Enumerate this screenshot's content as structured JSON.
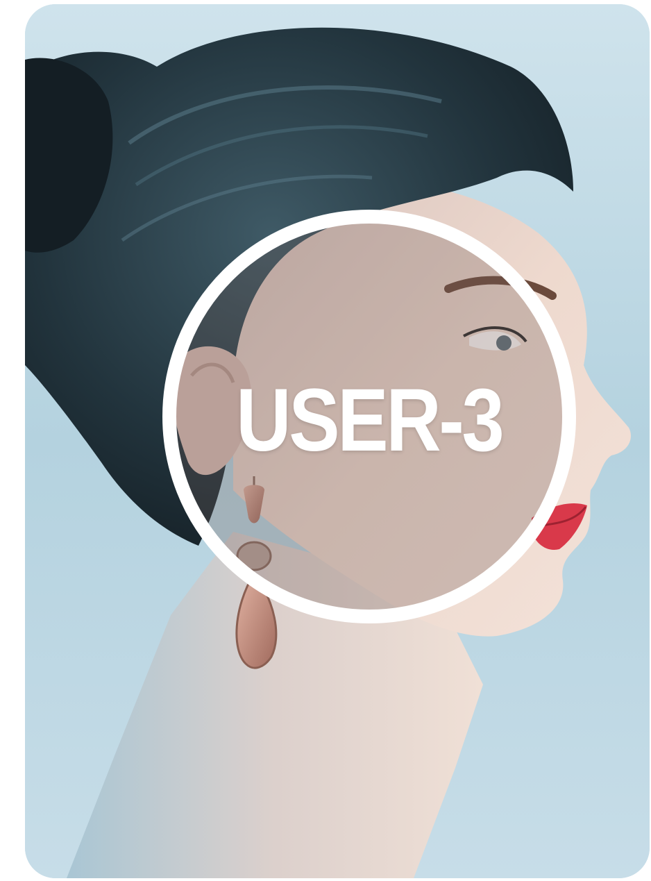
{
  "badge": {
    "label": "USER-3"
  },
  "photo": {
    "subject": "woman-profile-portrait",
    "colors": {
      "background": "#bcd7e3",
      "hair": "#1f2e36",
      "skin": "#e8cfc3",
      "lips": "#d9394a",
      "earring": "#c98b7a",
      "ring": "#ffffff"
    }
  }
}
